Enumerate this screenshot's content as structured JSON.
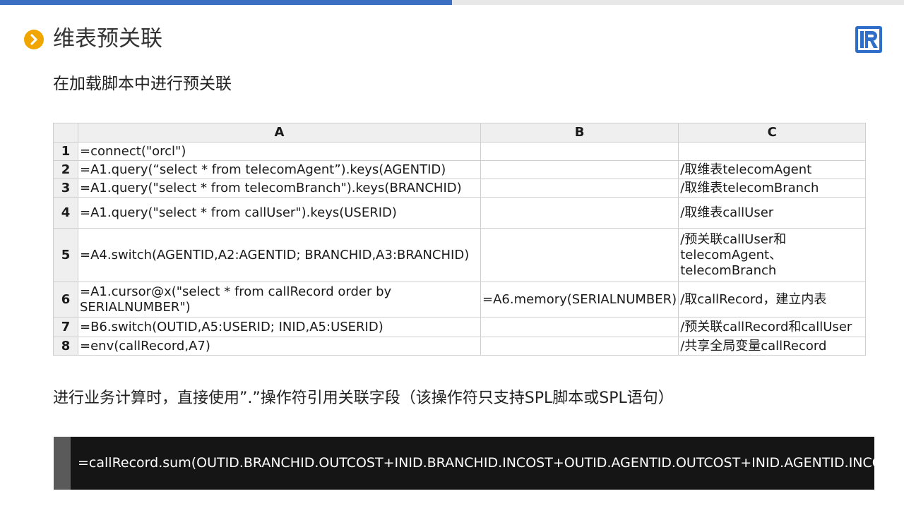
{
  "header": {
    "title": "维表预关联",
    "title_icon": "chevron-right-icon",
    "logo_icon": "r-logo-icon",
    "accent_color": "#3a6fc4",
    "icon_color": "#f0a500"
  },
  "subtitle": "在加载脚本中进行预关联",
  "grid": {
    "columns": [
      "A",
      "B",
      "C"
    ],
    "rows": [
      {
        "num": "1",
        "a": "=connect(\"orcl\")",
        "b": "",
        "c": ""
      },
      {
        "num": "2",
        "a": "=A1.query(“select * from telecomAgent”).keys(AGENTID)",
        "b": "",
        "c": "/取维表telecomAgent"
      },
      {
        "num": "3",
        "a": "=A1.query(\"select * from telecomBranch\").keys(BRANCHID)",
        "b": "",
        "c": "/取维表telecomBranch"
      },
      {
        "num": "4",
        "a": "=A1.query(\"select * from callUser\").keys(USERID)",
        "b": "",
        "c": "/取维表callUser"
      },
      {
        "num": "5",
        "a": "=A4.switch(AGENTID,A2:AGENTID; BRANCHID,A3:BRANCHID)",
        "b": "",
        "c": "/预关联callUser和telecomAgent、telecomBranch"
      },
      {
        "num": "6",
        "a": "=A1.cursor@x(\"select * from callRecord order by SERIALNUMBER\")",
        "b": "=A6.memory(SERIALNUMBER)",
        "c": "/取callRecord，建立内表"
      },
      {
        "num": "7",
        "a": "=B6.switch(OUTID,A5:USERID; INID,A5:USERID)",
        "b": "",
        "c": "/预关联callRecord和callUser"
      },
      {
        "num": "8",
        "a": "=env(callRecord,A7)",
        "b": "",
        "c": "/共享全局变量callRecord"
      }
    ]
  },
  "note": "进行业务计算时，直接使用”.”操作符引用关联字段（该操作符只支持SPL脚本或SPL语句）",
  "code": "=callRecord.sum(OUTID.BRANCHID.OUTCOST+INID.BRANCHID.INCOST+OUTID.AGENTID.OUTCOST+INID.AGENTID.INCOST)"
}
